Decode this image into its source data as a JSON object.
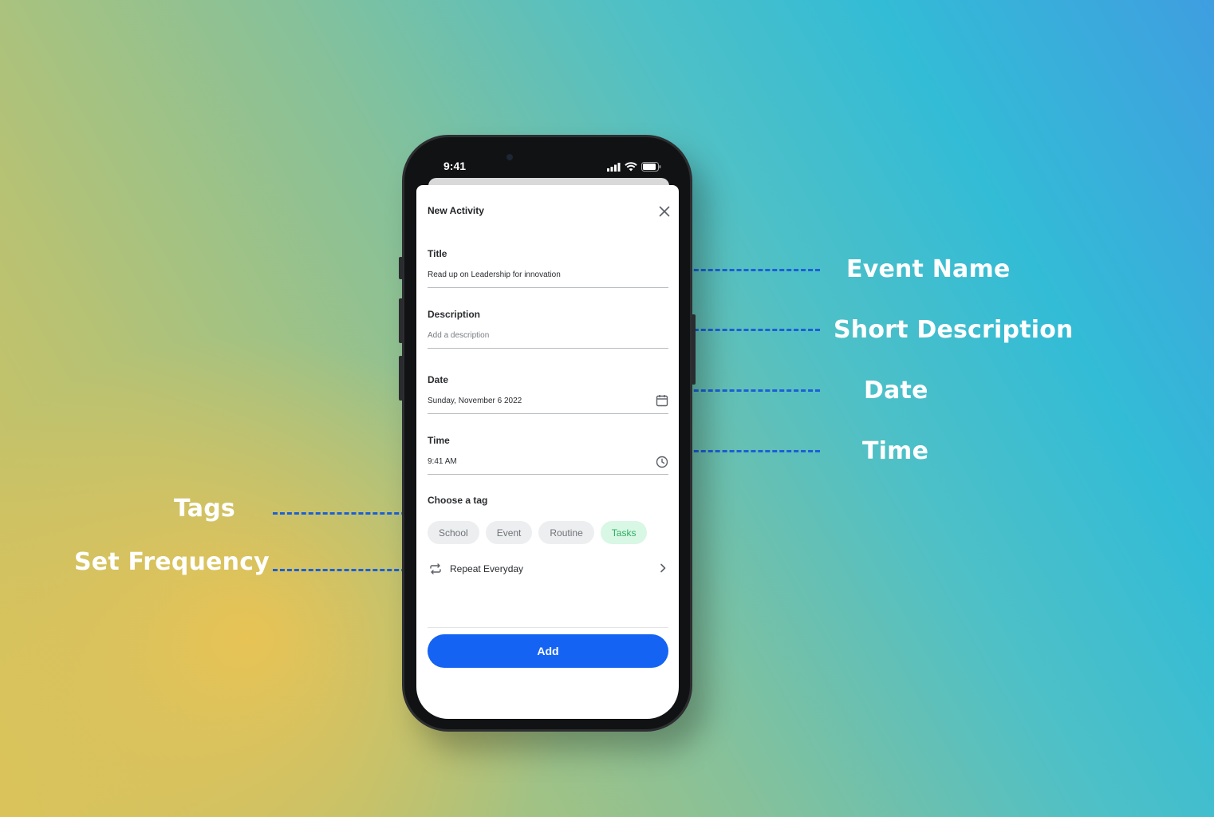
{
  "annotations": {
    "event_name": "Event Name",
    "short_description": "Short Description",
    "date": "Date",
    "time": "Time",
    "tags": "Tags",
    "set_frequency": "Set Frequency"
  },
  "colors": {
    "accent": "#1463f3",
    "annotation_line": "#1c5fd6",
    "tag_active_bg": "#d8f7e4",
    "tag_active_text": "#2fae63"
  },
  "status_bar": {
    "time": "9:41",
    "icons": [
      "signal-icon",
      "wifi-icon",
      "battery-icon"
    ]
  },
  "sheet": {
    "title": "New Activity",
    "close_icon": "close-icon"
  },
  "form": {
    "title": {
      "label": "Title",
      "value": "Read up on Leadership for innovation"
    },
    "description": {
      "label": "Description",
      "placeholder": "Add a description"
    },
    "date": {
      "label": "Date",
      "value": "Sunday, November 6 2022",
      "icon": "calendar-icon"
    },
    "time": {
      "label": "Time",
      "value": "9:41 AM",
      "icon": "clock-icon"
    }
  },
  "tags": {
    "label": "Choose a tag",
    "items": [
      {
        "label": "School",
        "selected": false
      },
      {
        "label": "Event",
        "selected": false
      },
      {
        "label": "Routine",
        "selected": false
      },
      {
        "label": "Tasks",
        "selected": true
      }
    ]
  },
  "repeat": {
    "label": "Repeat Everyday",
    "icon": "repeat-icon"
  },
  "add_button": {
    "label": "Add"
  }
}
